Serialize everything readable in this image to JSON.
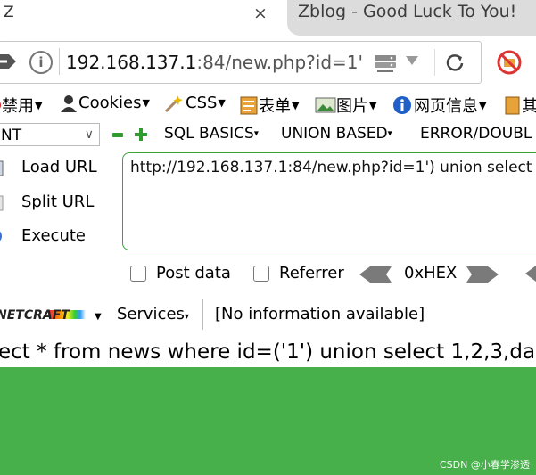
{
  "tabs": {
    "active_label": "Z",
    "close_glyph": "×",
    "inactive_label": "Zblog - Good Luck To You!"
  },
  "address": {
    "host": "192.168.137.1",
    "rest": ":84/new.php?id=1'"
  },
  "toolbar": {
    "items": [
      "禁用",
      "Cookies",
      "CSS",
      "表单",
      "图片",
      "网页信息",
      "其"
    ]
  },
  "hackbar": {
    "select_value": "NT",
    "menus": [
      "SQL BASICS",
      "UNION BASED",
      "ERROR/DOUBL"
    ],
    "load_url": "Load URL",
    "split_url": "Split URL",
    "execute": "Execute",
    "textarea_value": "http://192.168.137.1:84/new.php?id=1') union select",
    "post_data": "Post data",
    "referrer": "Referrer",
    "hex": "0xHEX"
  },
  "statusbar": {
    "services": "Services",
    "info": "[No information available]"
  },
  "page": {
    "query": "ect * from news where id=('1') union select 1,2,3,da",
    "watermark": "CSDN @小春学渗透"
  },
  "colors": {
    "page_green": "#48b04b",
    "textarea_border": "#3aa43a"
  }
}
